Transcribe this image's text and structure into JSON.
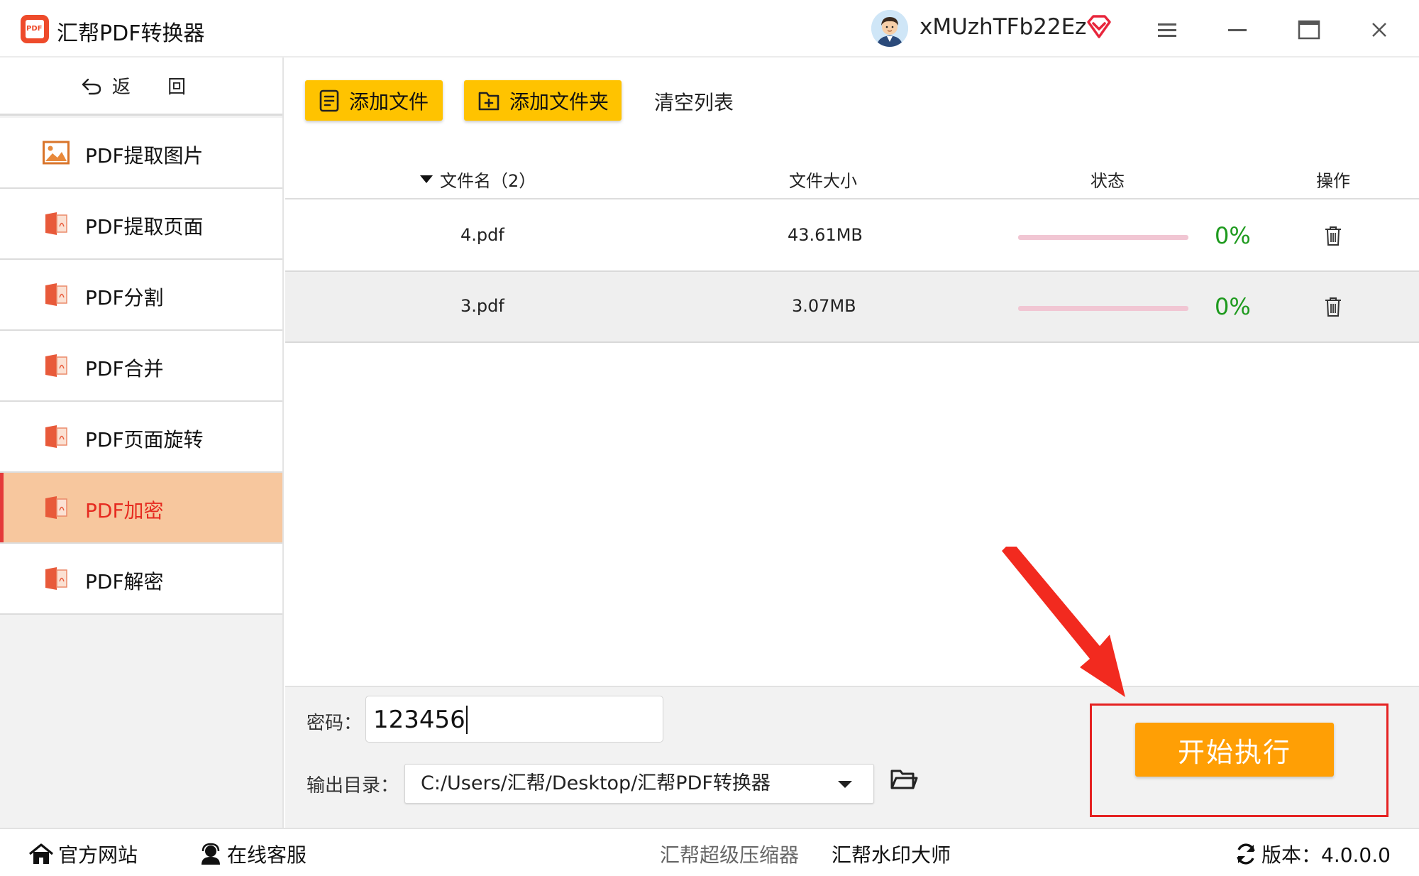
{
  "app": {
    "title": "汇帮PDF转换器",
    "logo_text": "PDF",
    "username": "xMUzhTFb22Ez"
  },
  "sidebar": {
    "back_label": "返 回",
    "items": [
      {
        "label": "PDF提取图片",
        "icon": "image-icon",
        "active": false
      },
      {
        "label": "PDF提取页面",
        "icon": "pdf-file-icon",
        "active": false
      },
      {
        "label": "PDF分割",
        "icon": "pdf-file-icon",
        "active": false
      },
      {
        "label": "PDF合并",
        "icon": "pdf-file-icon",
        "active": false
      },
      {
        "label": "PDF页面旋转",
        "icon": "pdf-file-icon",
        "active": false
      },
      {
        "label": "PDF加密",
        "icon": "pdf-file-icon",
        "active": true
      },
      {
        "label": "PDF解密",
        "icon": "pdf-file-icon",
        "active": false
      }
    ]
  },
  "toolbar": {
    "add_file": "添加文件",
    "add_folder": "添加文件夹",
    "clear_list": "清空列表"
  },
  "table": {
    "headers": {
      "name": "文件名（2）",
      "size": "文件大小",
      "status": "状态",
      "op": "操作"
    },
    "rows": [
      {
        "name": "4.pdf",
        "size": "43.61MB",
        "progress": 0,
        "percent": "0%"
      },
      {
        "name": "3.pdf",
        "size": "3.07MB",
        "progress": 0,
        "percent": "0%"
      }
    ]
  },
  "settings": {
    "password_label": "密码：",
    "password_value": "123456",
    "output_label": "输出目录：",
    "output_path": "C:/Users/汇帮/Desktop/汇帮PDF转换器",
    "start_button": "开始执行"
  },
  "footer": {
    "website": "官方网站",
    "support": "在线客服",
    "compressor": "汇帮超级压缩器",
    "watermark": "汇帮水印大师",
    "version": "版本：4.0.0.0"
  },
  "colors": {
    "accent_yellow": "#ffc300",
    "start_orange": "#ff9f05",
    "active_bg": "#f7c79e",
    "active_text": "#e62b20",
    "progress_green": "#1e9a1e",
    "annotation_red": "#e52222"
  }
}
